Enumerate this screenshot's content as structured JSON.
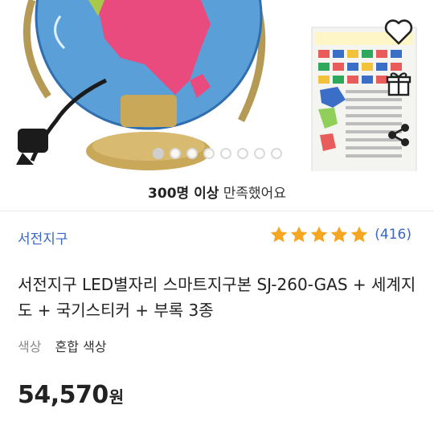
{
  "hero": {
    "image_alt": "지구본 상품 이미지",
    "carousel": {
      "total": 8,
      "active": 1
    }
  },
  "actions": {
    "like_icon": "heart-outline-icon",
    "gift_icon": "gift-icon",
    "share_icon": "share-icon"
  },
  "satisfaction": {
    "count": "300명 이상",
    "suffix": "만족했어요"
  },
  "product": {
    "brand": "서전지구",
    "rating": {
      "stars": 5,
      "value_fraction": 1.0,
      "star_color": "#f5a623"
    },
    "review_count": "(416)",
    "title": "서전지구 LED별자리 스마트지구본 SJ-260-GAS + 세계지도 + 국기스티커 + 부록 3종",
    "option": {
      "label": "색상",
      "value": "혼합 색상"
    },
    "price": {
      "amount": "54,570",
      "unit": "원"
    }
  },
  "colors": {
    "brand_link": "#3a66c8",
    "star": "#f5a623"
  }
}
